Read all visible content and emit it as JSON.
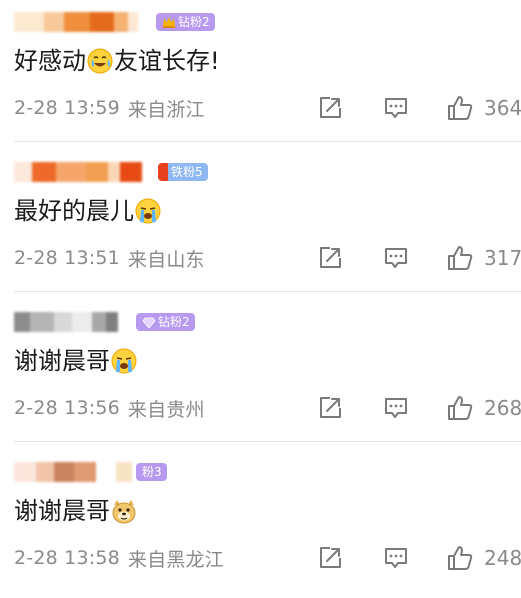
{
  "colors": {
    "meta_gray": "#8a8a8a",
    "icon_gray": "#7a7a7a",
    "text_dark": "#1a1a1a",
    "divider": "#e6e6e6",
    "badge_purple": "#b79af0",
    "badge_blue": "#8fb8f2"
  },
  "comments": [
    {
      "badge_label": "钻粉2",
      "badge_icon": "crown-icon",
      "text_before": "好感动",
      "emoji_name": "tearful-smile-emoji-icon",
      "text_after": "友谊长存!",
      "date": "2-28 13:59",
      "location": "来自浙江",
      "likes": "364"
    },
    {
      "badge_label": "铁粉5",
      "badge_icon": "",
      "text_before": "最好的晨儿",
      "emoji_name": "crying-emoji-icon",
      "text_after": "",
      "date": "2-28 13:51",
      "location": "来自山东",
      "likes": "317"
    },
    {
      "badge_label": "钻粉2",
      "badge_icon": "diamond-icon",
      "text_before": "谢谢晨哥",
      "emoji_name": "crying-emoji-icon",
      "text_after": "",
      "date": "2-28 13:56",
      "location": "来自贵州",
      "likes": "268"
    },
    {
      "badge_label": "粉3",
      "badge_icon": "",
      "text_before": "谢谢晨哥",
      "emoji_name": "doge-emoji-icon",
      "text_after": "",
      "date": "2-28 13:58",
      "location": "来自黑龙江",
      "likes": "248"
    }
  ]
}
